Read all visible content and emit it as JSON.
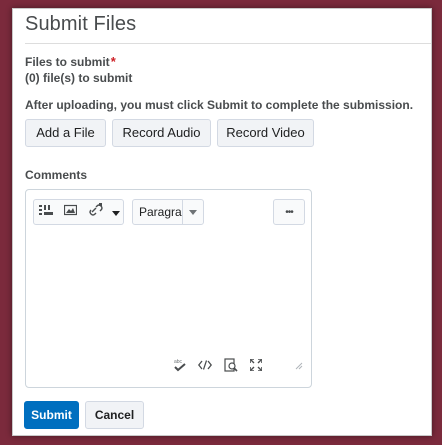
{
  "dialog": {
    "title": "Submit Files"
  },
  "files": {
    "label": "Files to submit",
    "required_mark": "*",
    "count_text": "(0) file(s) to submit",
    "instruction": "After uploading, you must click Submit to complete the submission."
  },
  "upload_buttons": {
    "add_file": "Add a File",
    "record_audio": "Record Audio",
    "record_video": "Record Video"
  },
  "comments": {
    "label": "Comments",
    "format_select": "Paragra",
    "more_label": "•••"
  },
  "icons": {
    "toolbar": [
      "insert-stuff-icon",
      "insert-image-icon",
      "insert-link-icon",
      "dropdown-arrow-icon",
      "paragraph-dropdown-icon",
      "more-options-icon"
    ],
    "statusbar": [
      "spellcheck-icon",
      "source-code-icon",
      "preview-icon",
      "fullscreen-icon",
      "resize-handle-icon"
    ]
  },
  "colors": {
    "frame": "#7b2a3c",
    "primary": "#006fbf",
    "required": "#cd2026",
    "text": "#494c4e"
  },
  "actions": {
    "submit": "Submit",
    "cancel": "Cancel"
  }
}
